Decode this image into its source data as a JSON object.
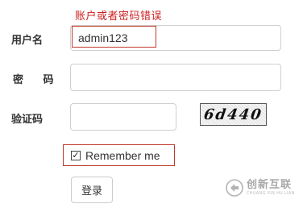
{
  "form": {
    "error_message": "账户或者密码错误",
    "username_label": "用户名",
    "username_value": "admin123",
    "password_label": "密 码",
    "password_value": "",
    "captcha_label": "验证码",
    "captcha_value": "",
    "captcha_image_text": "6d440",
    "remember_label": "Remember me",
    "remember_checked": "✓",
    "login_button": "登录"
  },
  "watermark": {
    "name": "创新互联",
    "subtitle": "CHUANG XIN HU LIAN"
  },
  "colors": {
    "error": "#cc1f1f",
    "highlight_border": "#c0392b",
    "input_border": "#cfcfcf"
  }
}
